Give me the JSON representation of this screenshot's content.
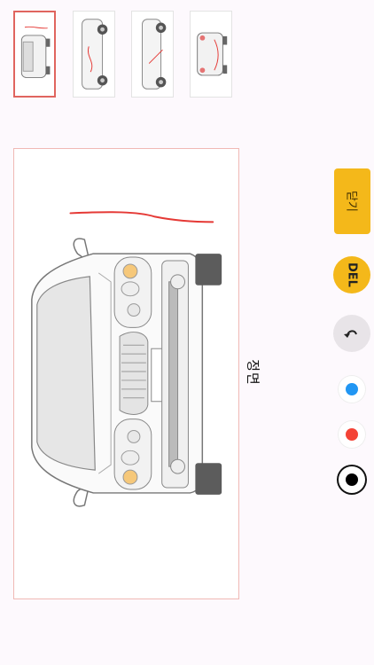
{
  "thumbnails": [
    {
      "view": "front",
      "selected": true
    },
    {
      "view": "left-side",
      "selected": false
    },
    {
      "view": "rear",
      "selected": false
    },
    {
      "view": "right-side",
      "selected": false
    }
  ],
  "canvas": {
    "view_label": "정면",
    "stroke_color": "#e53935"
  },
  "controls": {
    "close_label": "닫기",
    "delete_label": "DEL",
    "undo_icon": "undo-icon",
    "accent_color": "#f4b81a"
  },
  "colors": [
    {
      "name": "blue",
      "hex": "#2196f3",
      "selected": false
    },
    {
      "name": "red",
      "hex": "#f44336",
      "selected": false
    },
    {
      "name": "black",
      "hex": "#000000",
      "selected": true
    }
  ]
}
